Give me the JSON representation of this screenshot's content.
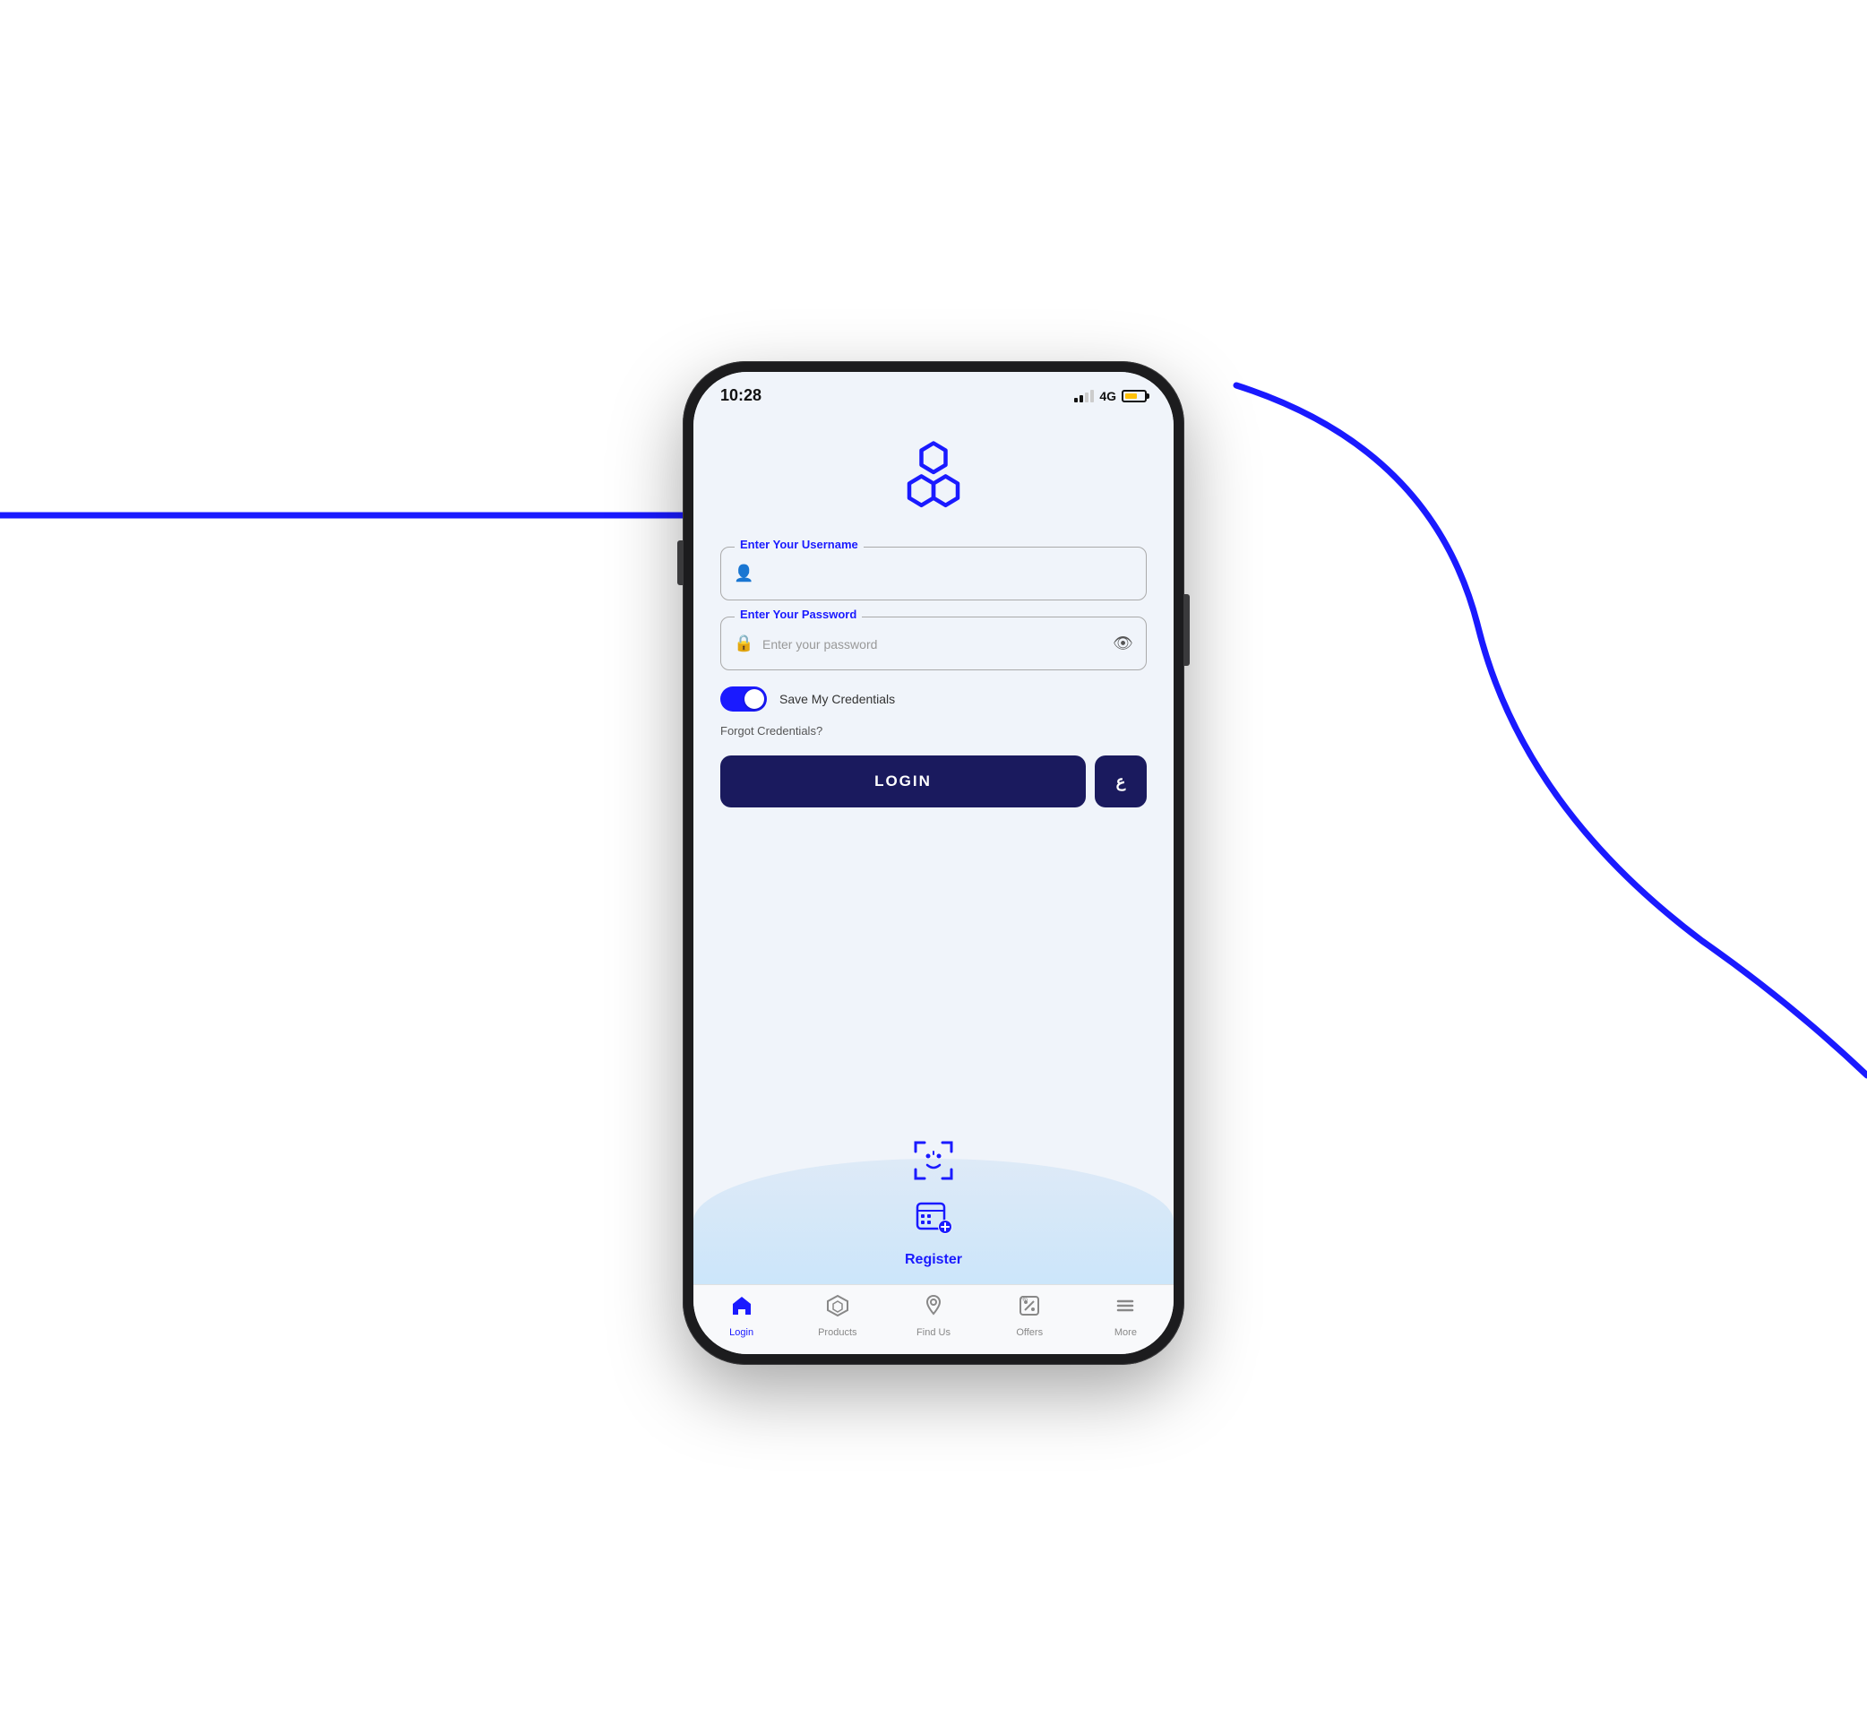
{
  "status_bar": {
    "time": "10:28",
    "network": "4G"
  },
  "logo": {
    "alt": "App Logo"
  },
  "form": {
    "username_label": "Enter Your Username",
    "username_placeholder": "",
    "password_label": "Enter Your Password",
    "password_placeholder": "Enter your password",
    "save_credentials_label": "Save My Credentials",
    "forgot_label": "Forgot Credentials?",
    "login_button": "LOGIN",
    "lang_button": "ع"
  },
  "bottom_wave": {
    "register_label": "Register"
  },
  "nav": {
    "items": [
      {
        "label": "Login",
        "active": true
      },
      {
        "label": "Products",
        "active": false
      },
      {
        "label": "Find Us",
        "active": false
      },
      {
        "label": "Offers",
        "active": false
      },
      {
        "label": "More",
        "active": false
      }
    ]
  },
  "colors": {
    "brand_blue": "#1a1aff",
    "dark_navy": "#1a1a5e",
    "bg": "#f0f4fa"
  }
}
